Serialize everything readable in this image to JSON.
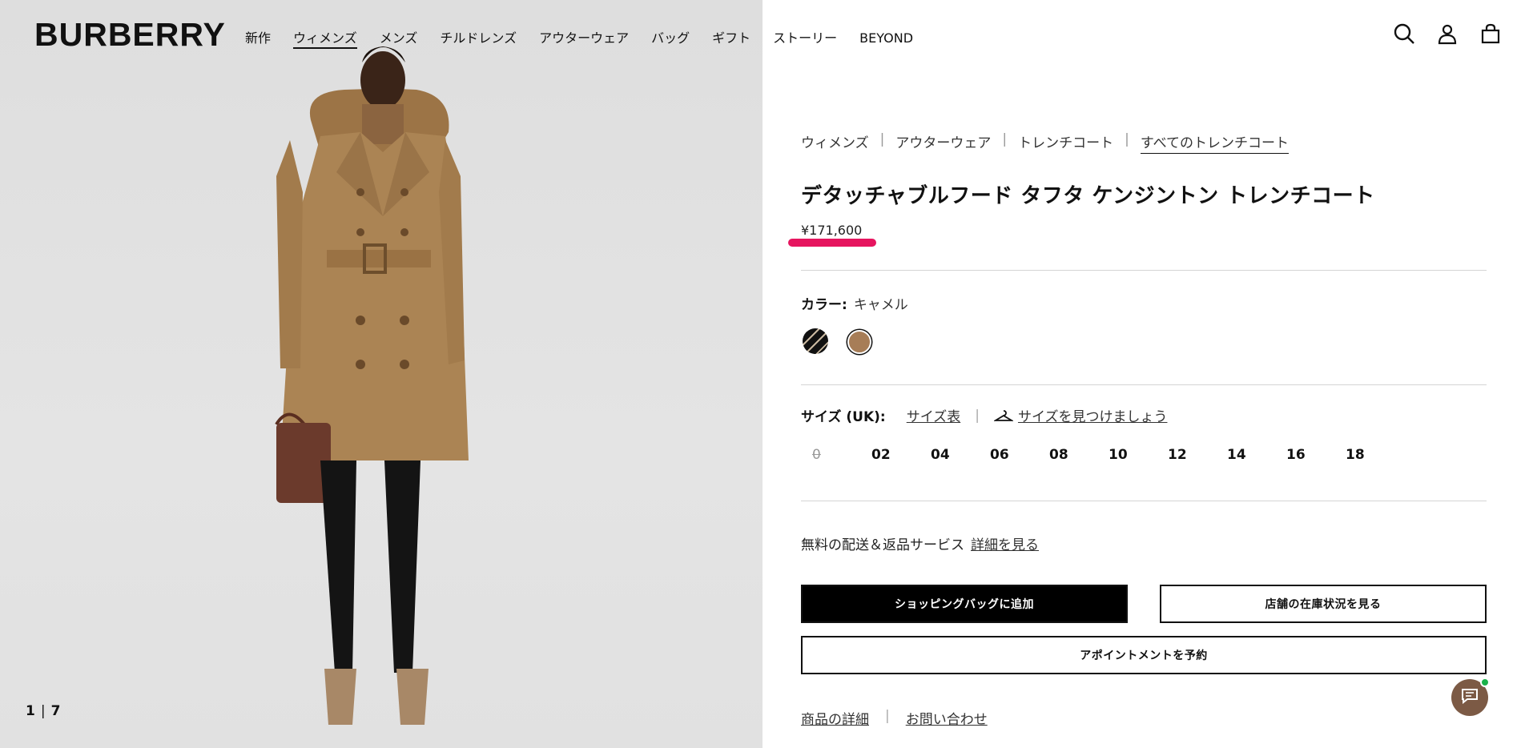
{
  "header": {
    "logo": "BURBERRY",
    "nav": [
      "新作",
      "ウィメンズ",
      "メンズ",
      "チルドレンズ",
      "アウターウェア",
      "バッグ",
      "ギフト",
      "ストーリー",
      "BEYOND"
    ],
    "icons": [
      "search-icon",
      "account-icon",
      "shopping-bag-icon"
    ]
  },
  "gallery": {
    "current": "1",
    "separator": "|",
    "total": "7"
  },
  "breadcrumb": [
    "ウィメンズ",
    "アウターウェア",
    "トレンチコート",
    "すべてのトレンチコート"
  ],
  "product": {
    "title": "デタッチャブルフード タフタ ケンジントン トレンチコート",
    "price": "¥171,600"
  },
  "color": {
    "label": "カラー:",
    "selected": "キャメル",
    "swatches": [
      "check-pattern",
      "camel"
    ],
    "camel_hex": "#a77d57"
  },
  "size": {
    "label": "サイズ (UK):",
    "chart_link": "サイズ表",
    "finder_link": "サイズを見つけましょう",
    "options": [
      "0",
      "02",
      "04",
      "06",
      "08",
      "10",
      "12",
      "14",
      "16",
      "18"
    ],
    "unavailable": [
      "0"
    ]
  },
  "shipping": {
    "text": "無料の配送＆返品サービス",
    "link": "詳細を見る"
  },
  "buttons": {
    "add_to_bag": "ショッピングバッグに追加",
    "store_stock": "店舗の在庫状況を見る",
    "appointment": "アポイントメントを予約"
  },
  "footer_links": [
    "商品の詳細",
    "お問い合わせ"
  ],
  "colors": {
    "accent": "#e6155f",
    "chat": "#7c5a45",
    "online": "#1bb24b"
  }
}
